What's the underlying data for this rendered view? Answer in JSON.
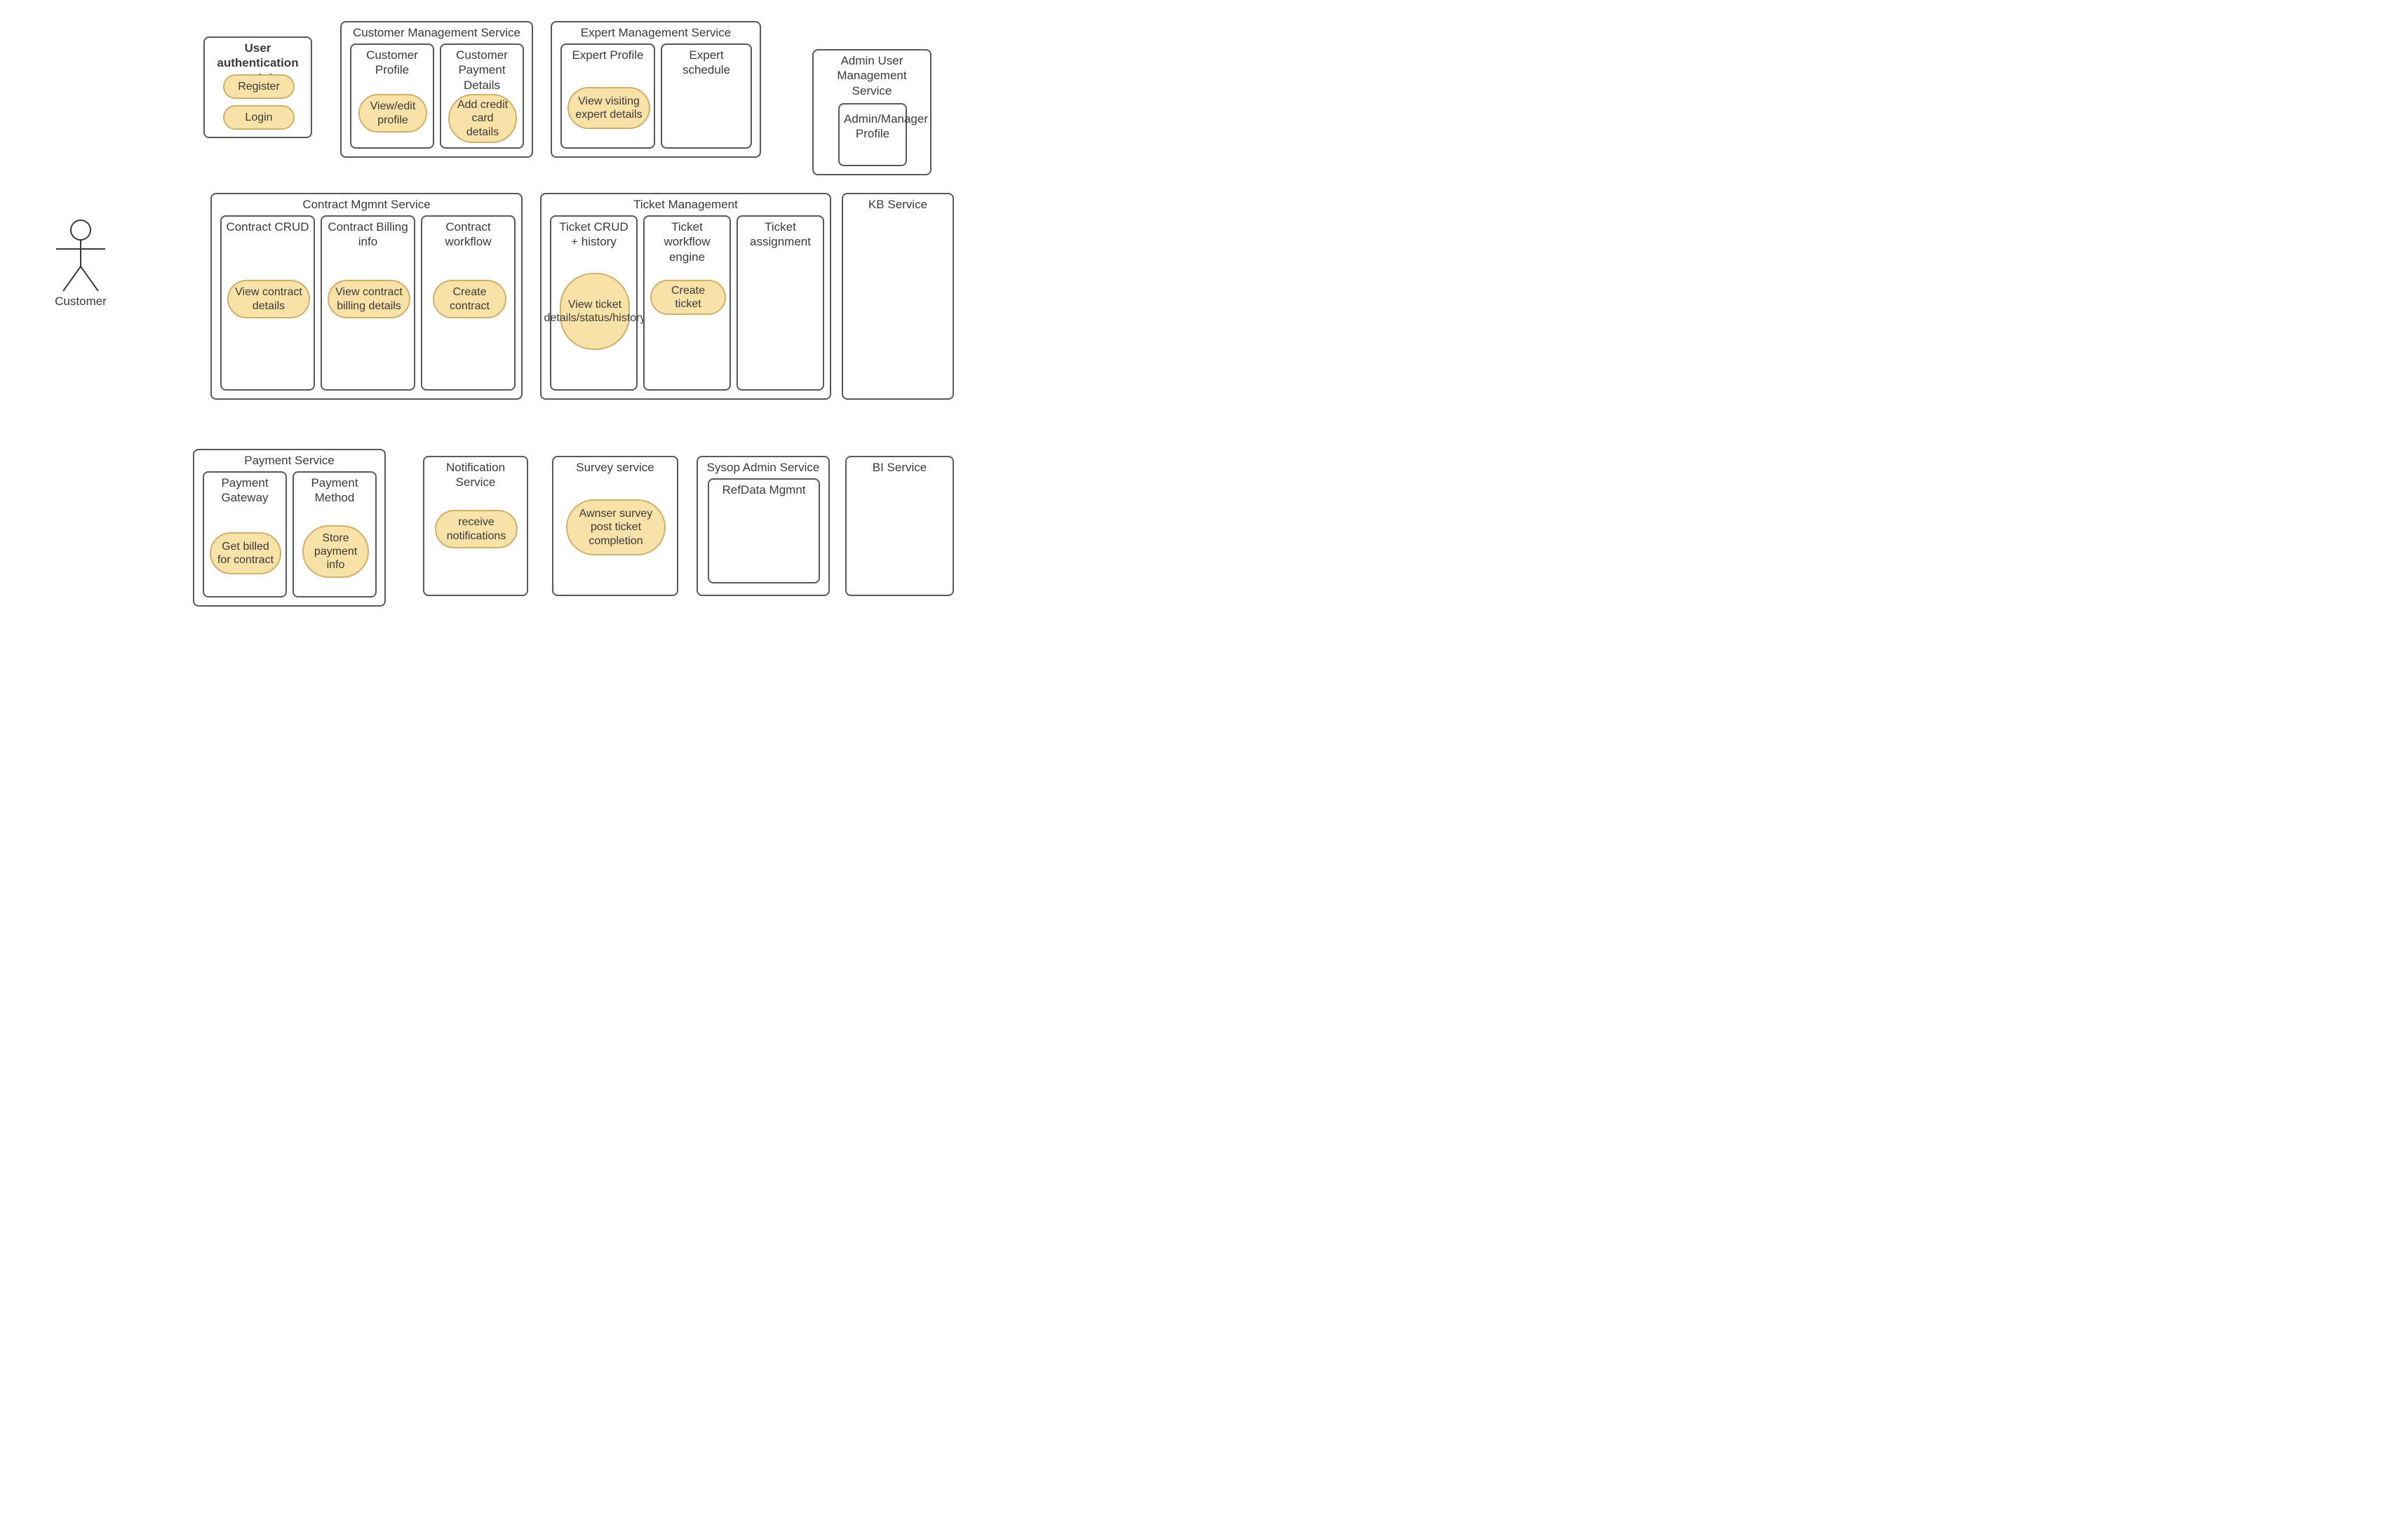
{
  "actor": {
    "label": "Customer"
  },
  "auth": {
    "title": "User authentication module",
    "register": "Register",
    "login": "Login"
  },
  "customerMgmt": {
    "title": "Customer  Management Service",
    "profile": {
      "title": "Customer Profile",
      "action": "View/edit profile"
    },
    "payment": {
      "title": "Customer Payment Details",
      "action": "Add credit card details"
    }
  },
  "expertMgmt": {
    "title": "Expert Management Service",
    "profile": {
      "title": "Expert Profile",
      "action": "View visiting expert details"
    },
    "schedule": {
      "title": "Expert schedule"
    }
  },
  "adminUser": {
    "title": "Admin User Management Service",
    "profile": {
      "title": "Admin/Manager Profile"
    }
  },
  "contract": {
    "title": "Contract Mgmnt Service",
    "crud": {
      "title": "Contract CRUD",
      "action": "View contract details"
    },
    "billing": {
      "title": "Contract Billing info",
      "action": "View contract billing details"
    },
    "workflow": {
      "title": "Contract workflow",
      "action": "Create contract"
    }
  },
  "ticket": {
    "title": "Ticket Management",
    "crud": {
      "title": "Ticket CRUD + history",
      "action": "View ticket details/status/history"
    },
    "workflow": {
      "title": "Ticket workflow engine",
      "action": "Create ticket"
    },
    "assign": {
      "title": "Ticket assignment"
    }
  },
  "kb": {
    "title": "KB Service"
  },
  "payment": {
    "title": "Payment Service",
    "gateway": {
      "title": "Payment Gateway",
      "action": "Get billed for contract"
    },
    "method": {
      "title": "Payment Method",
      "action": "Store payment info"
    }
  },
  "notification": {
    "title": "Notification Service",
    "action": "receive notifications"
  },
  "survey": {
    "title": "Survey service",
    "action": "Awnser survey post ticket completion"
  },
  "sysop": {
    "title": "Sysop Admin Service",
    "refdata": {
      "title": "RefData Mgmnt"
    }
  },
  "bi": {
    "title": "BI Service"
  }
}
